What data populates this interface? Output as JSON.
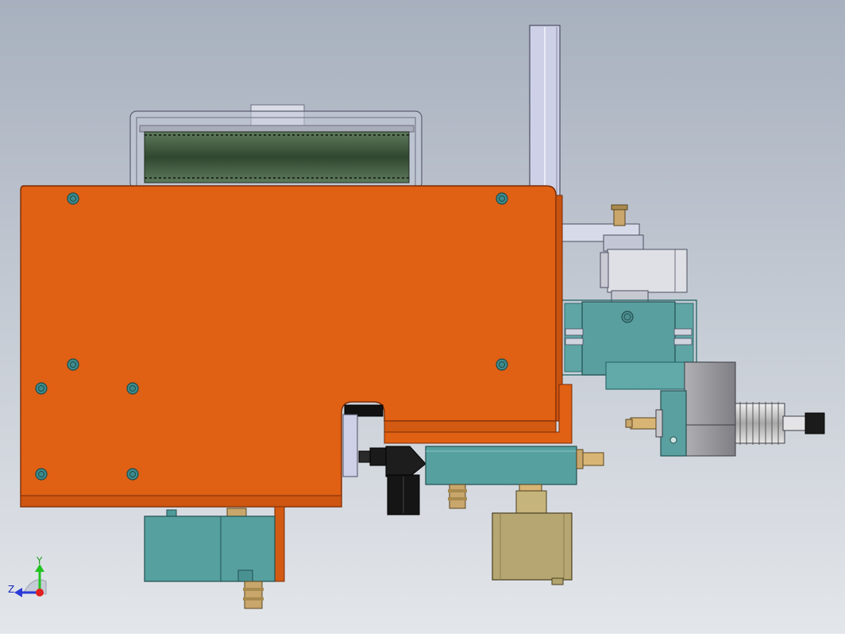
{
  "viewport": {
    "background_top": "#a7b0be",
    "background_bottom": "#e3e6ea"
  },
  "colors": {
    "orange_plate": "#e06014",
    "orange_edge": "#b24408",
    "teal": "#4f9a9b",
    "teal_dark": "#2d6b6d",
    "steel": "#cfd4e3",
    "steel_dark": "#7c8092",
    "dark_green_belt": "#3f5a3e",
    "brass": "#c9a66b",
    "khaki": "#b6a672",
    "gray_block": "#9a9a9e",
    "black_fitting": "#1a1a1a",
    "axis_y": "#22c322",
    "axis_z": "#2a3ad8",
    "axis_origin": "#e02020"
  },
  "triad": {
    "y_label": "Y",
    "z_label": "Z"
  }
}
